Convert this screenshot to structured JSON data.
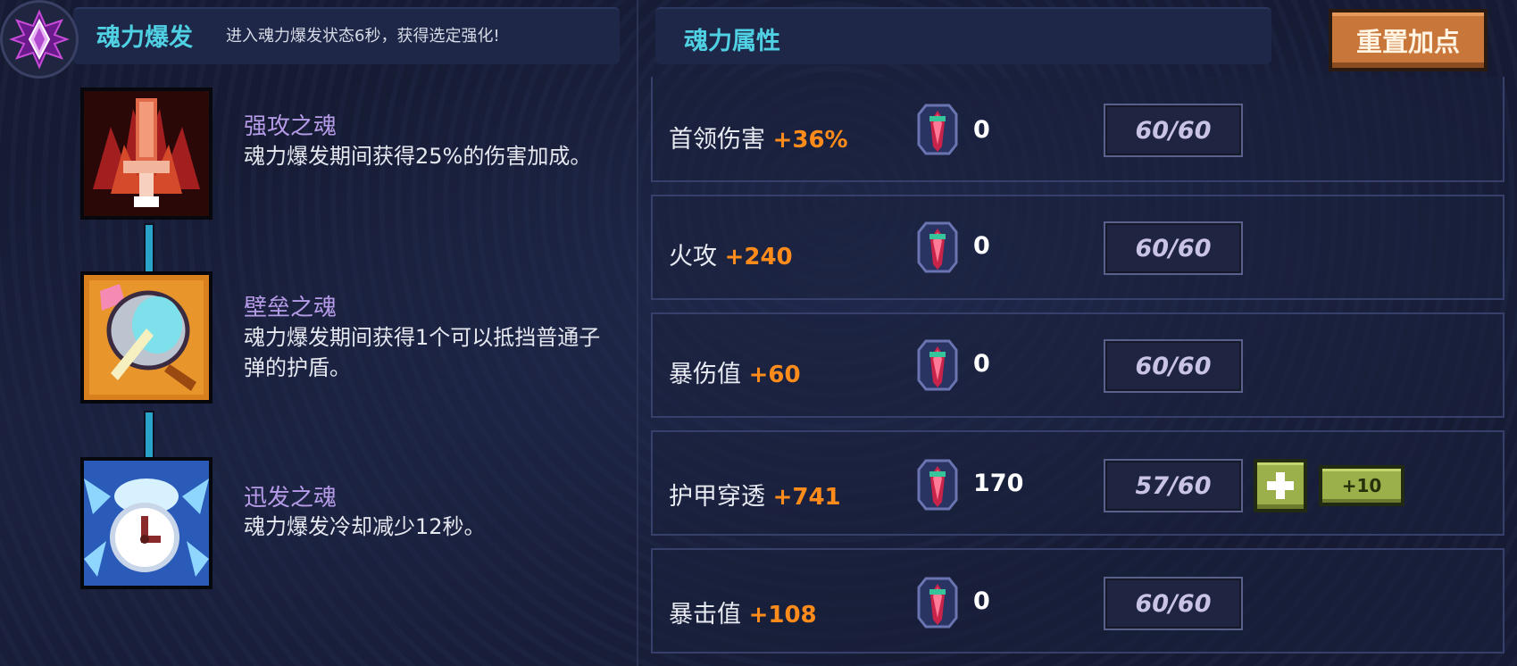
{
  "burst": {
    "title": "魂力爆发",
    "description": "进入魂力爆发状态6秒，获得选定强化!"
  },
  "skills": [
    {
      "name": "强攻之魂",
      "description": "魂力爆发期间获得25%的伤害加成。",
      "icon": "flame-sword-icon"
    },
    {
      "name": "壁垒之魂",
      "description": "魂力爆发期间获得1个可以抵挡普通子弹的护盾。",
      "icon": "shield-icon"
    },
    {
      "name": "迅发之魂",
      "description": "魂力爆发冷却减少12秒。",
      "icon": "clock-icon"
    }
  ],
  "attributes": {
    "title": "魂力属性",
    "reset_label": "重置加点",
    "rows": [
      {
        "name": "首领伤害",
        "bonus": "+36%",
        "gems": "0",
        "level": "60/60"
      },
      {
        "name": "火攻",
        "bonus": "+240",
        "gems": "0",
        "level": "60/60"
      },
      {
        "name": "暴伤值",
        "bonus": "+60",
        "gems": "0",
        "level": "60/60"
      },
      {
        "name": "护甲穿透",
        "bonus": "+741",
        "gems": "170",
        "level": "57/60",
        "plus_label": "+",
        "plus10_label": "+10"
      },
      {
        "name": "暴击值",
        "bonus": "+108",
        "gems": "0",
        "level": "60/60"
      }
    ]
  },
  "colors": {
    "accent_cyan": "#4fd1e3",
    "bonus_orange": "#ff8c1a",
    "skill_title": "#b59be8",
    "reset_button": "#c8763a",
    "plus_button": "#9bb04a"
  }
}
